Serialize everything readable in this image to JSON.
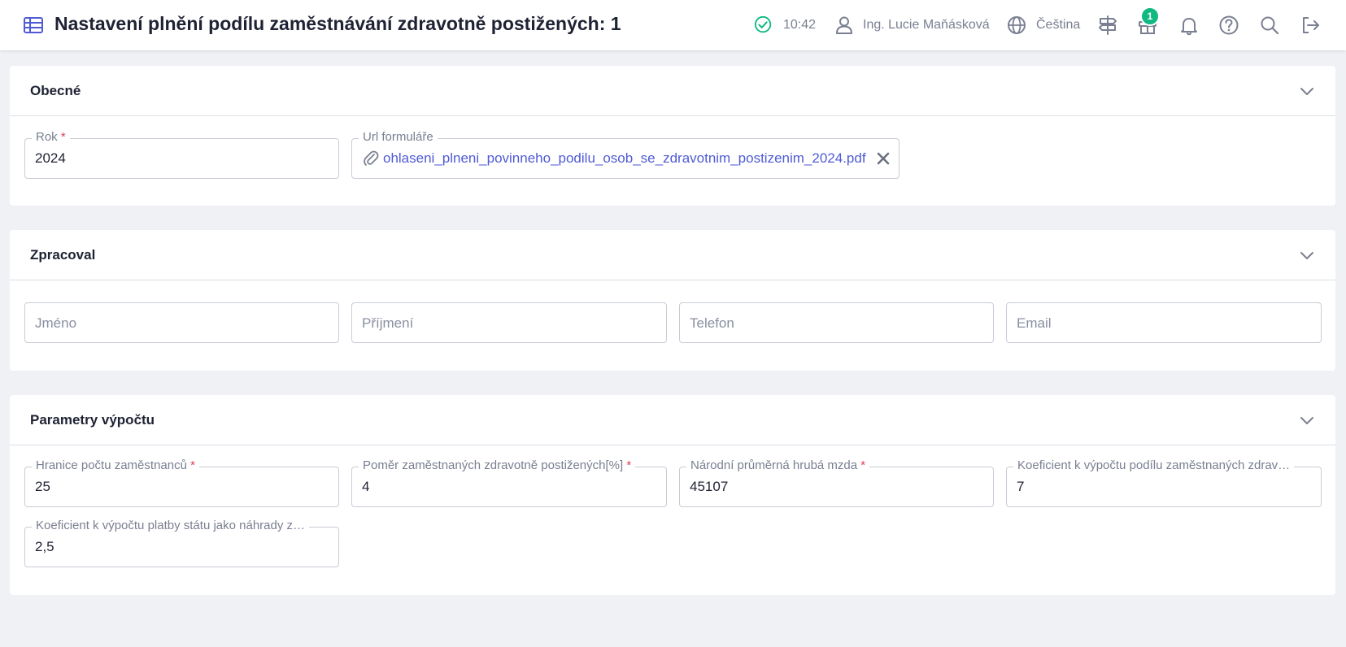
{
  "header": {
    "title": "Nastavení plnění podílu zaměstnávání zdravotně postižených: 1",
    "time": "10:42",
    "user_name": "Ing. Lucie Maňásková",
    "language": "Čeština",
    "gift_badge_count": "1"
  },
  "sections": {
    "general": {
      "title": "Obecné",
      "year_label": "Rok",
      "year_value": "2024",
      "url_label": "Url formuláře",
      "url_value": "ohlaseni_plneni_povinneho_podilu_osob_se_zdravotnim_postizenim_2024.pdf"
    },
    "processed_by": {
      "title": "Zpracoval",
      "first_name_placeholder": "Jméno",
      "last_name_placeholder": "Příjmení",
      "phone_placeholder": "Telefon",
      "email_placeholder": "Email"
    },
    "calc_params": {
      "title": "Parametry výpočtu",
      "employee_limit_label": "Hranice počtu zaměstnanců",
      "employee_limit_value": "25",
      "ratio_label": "Poměr zaměstnaných zdravotně postižených[%]",
      "ratio_value": "4",
      "national_wage_label": "Národní průměrná hrubá mzda",
      "national_wage_value": "45107",
      "share_coef_label": "Koeficient k výpočtu podílu zaměstnaných zdrav…",
      "share_coef_value": "7",
      "state_coef_label": "Koeficient k výpočtu platby státu jako náhrady z…",
      "state_coef_value": "2,5"
    }
  },
  "colors": {
    "accent": "#4f5bd5",
    "success": "#10b981",
    "required": "#e53e5a",
    "background": "#f0f1f5"
  }
}
